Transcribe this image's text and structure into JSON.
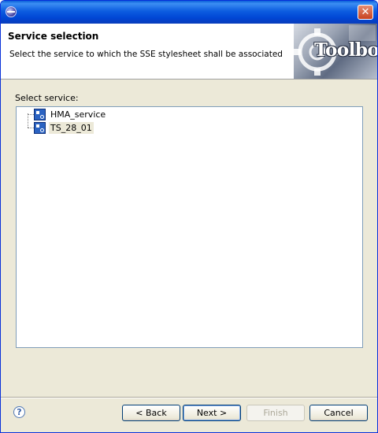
{
  "window": {
    "title": ""
  },
  "header": {
    "title": "Service selection",
    "description": "Select the service to which the SSE stylesheet shall be associated",
    "banner_text": "Toolbox"
  },
  "main": {
    "select_label": "Select service:",
    "services": [
      {
        "label": "HMA_service",
        "selected": false
      },
      {
        "label": "TS_28_01",
        "selected": true
      }
    ]
  },
  "footer": {
    "help": "?",
    "back_label": "< Back",
    "next_label": "Next >",
    "finish_label": "Finish",
    "cancel_label": "Cancel"
  },
  "icons": {
    "titlebar": "app-icon",
    "close": "close-icon",
    "service": "service-node-icon",
    "help": "help-icon"
  },
  "colors": {
    "titlebar": "#0046d5",
    "dialog_bg": "#ece9d8",
    "tree_border": "#7f9db9",
    "service_icon": "#2b63c2"
  }
}
